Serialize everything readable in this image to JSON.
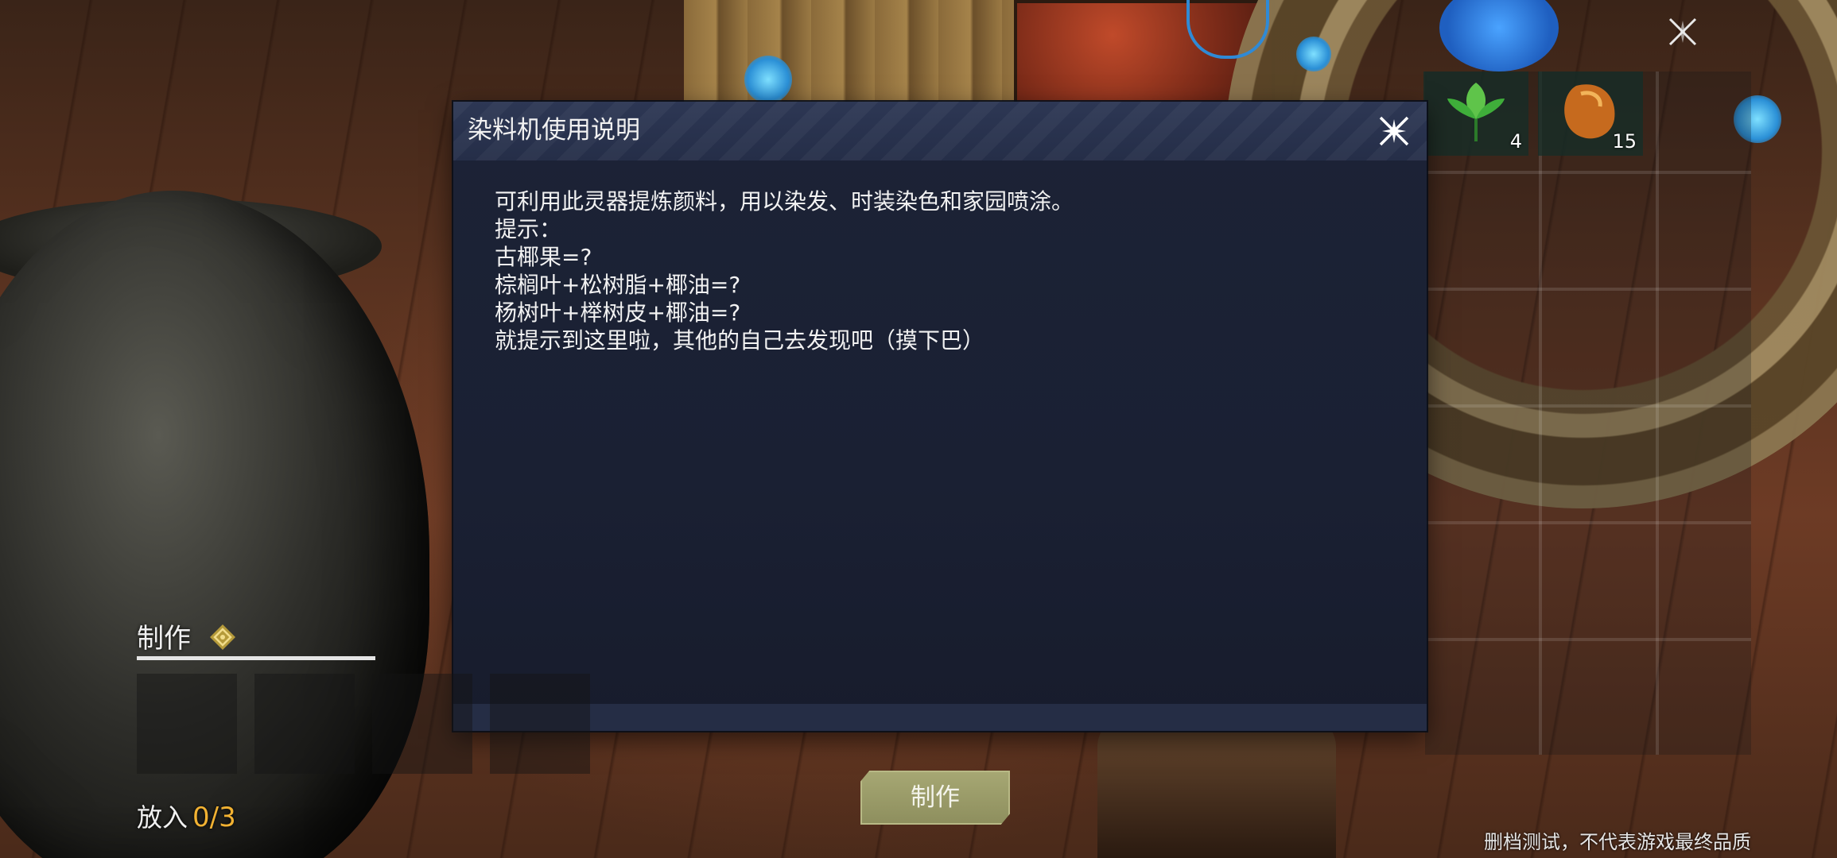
{
  "dialog": {
    "title": "染料机使用说明",
    "lines": [
      "可利用此灵器提炼颜料，用以染发、时装染色和家园喷涂。",
      "提示：",
      "古椰果=?",
      "棕榈叶+松树脂+椰油=?",
      "杨树叶+榉树皮+椰油=?",
      "就提示到这里啦，其他的自己去发现吧（摸下巴）"
    ],
    "close_icon": "close-icon"
  },
  "inventory": {
    "items": [
      {
        "icon": "leaf-icon",
        "count": "4",
        "color": "#3fae3a"
      },
      {
        "icon": "amber-icon",
        "count": "15",
        "color": "#c66a1e"
      }
    ]
  },
  "craft_panel": {
    "label": "制作",
    "badge_icon": "diamond-badge-icon",
    "put_in_label": "放入",
    "put_in_count": "0/3",
    "slot_count": 4
  },
  "make_button": {
    "label": "制作"
  },
  "footer": {
    "disclaimer": "删档测试，不代表游戏最终品质"
  },
  "colors": {
    "dialog_bg": "#1a2033",
    "dialog_header": "#2d3754",
    "accent_count": "#f2b232",
    "make_button": "#a6a773"
  }
}
